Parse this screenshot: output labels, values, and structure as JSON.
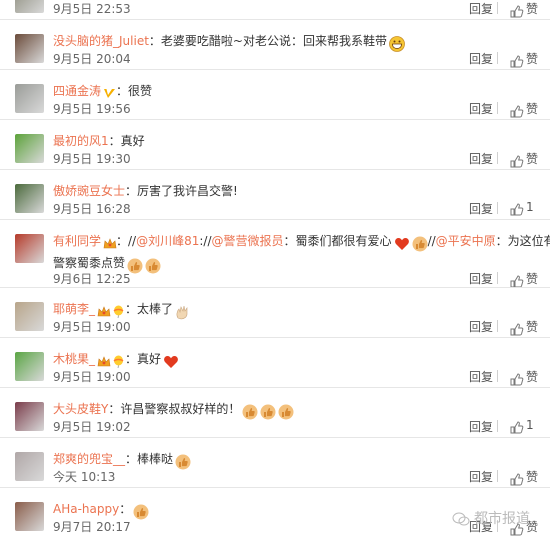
{
  "comments": [
    {
      "username": "",
      "text": "",
      "time": "9月5日 22:53",
      "reply": "回复",
      "like": "赞",
      "avatar_color": "#8a8a7a"
    },
    {
      "username": "没头脑的猪_Juliet",
      "text": "：老婆要吃醋啦~对老公说：回来帮我系鞋带",
      "time": "9月5日 20:04",
      "reply": "回复",
      "like": "赞",
      "avatar_color": "#6b4b3a",
      "emoji": "grin-emoji"
    },
    {
      "username": "四通金涛",
      "text": "：很赞",
      "time": "9月5日 19:56",
      "reply": "回复",
      "like": "赞",
      "avatar_color": "#9a9c98",
      "badge": "v-badge"
    },
    {
      "username": "最初的风1",
      "text": "：真好",
      "time": "9月5日 19:30",
      "reply": "回复",
      "like": "赞",
      "avatar_color": "#5ca23a"
    },
    {
      "username": "傲娇豌豆女士",
      "text": "：厉害了我许昌交警!",
      "time": "9月5日 16:28",
      "reply": "回复",
      "like": "1",
      "avatar_color": "#4b6a3c"
    },
    {
      "username": "有利同学",
      "text_parts": [
        "：//",
        "@刘川峰81",
        "://",
        "@警营微报员",
        "：蜀黍们都很有爱心",
        "//",
        "@平安中原",
        "：为这位有爱的"
      ],
      "text_line2": "警察蜀黍点赞",
      "time": "9月6日 12:25",
      "reply": "回复",
      "like": "赞",
      "avatar_color": "#b53a2a"
    },
    {
      "username": "耶萌李_",
      "text": "：太棒了",
      "time": "9月5日 19:00",
      "reply": "回复",
      "like": "赞",
      "avatar_color": "#b8a58a"
    },
    {
      "username": "木桃果_",
      "text": "：真好",
      "time": "9月5日 19:00",
      "reply": "回复",
      "like": "赞",
      "avatar_color": "#5aa544"
    },
    {
      "username": "大头皮鞋Y",
      "text": "：许昌警察叔叔好样的！",
      "time": "9月5日 19:02",
      "reply": "回复",
      "like": "1",
      "avatar_color": "#7a3c4a"
    },
    {
      "username": "郑爽的兜宝__",
      "text": "：棒棒哒",
      "time": "今天 10:13",
      "reply": "回复",
      "like": "赞",
      "avatar_color": "#b0a7a7"
    },
    {
      "username": "AHa-happy",
      "text": "：",
      "time": "9月7日 20:17",
      "reply": "回复",
      "like": "赞",
      "avatar_color": "#8a5d4a"
    }
  ],
  "watermark": "都市报道",
  "colors": {
    "username": "#eb7350",
    "text": "#333333",
    "meta": "#666666",
    "separator": "#e6e6e6"
  }
}
